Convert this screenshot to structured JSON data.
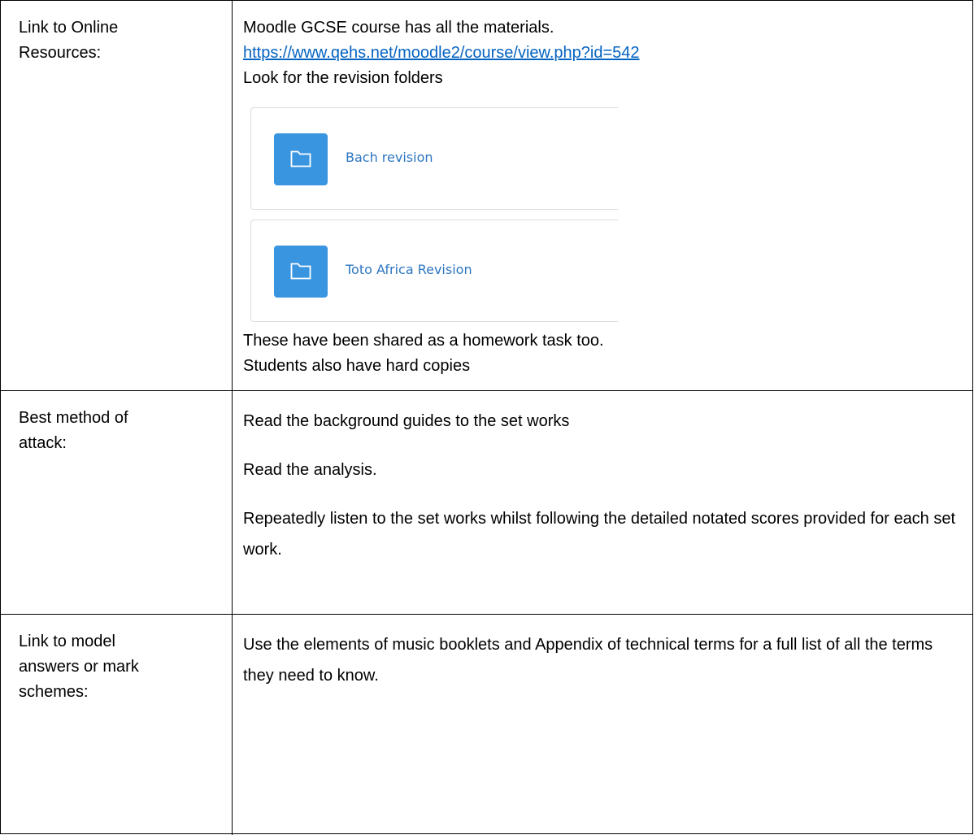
{
  "rows": [
    {
      "label": "Link to Online Resources:",
      "label_lines": [
        "Link to Online",
        "Resources:"
      ],
      "intro": "Moodle GCSE course has all the materials.",
      "url": "https://www.qehs.net/moodle2/course/view.php?id=542",
      "look_for": "Look for the revision folders",
      "folders": [
        {
          "name": "Bach revision",
          "icon": "folder-icon"
        },
        {
          "name": "Toto Africa Revision",
          "icon": "folder-icon"
        }
      ],
      "after_1": "These have been shared as a homework task too.",
      "after_2": "Students also have hard copies"
    },
    {
      "label": "Best method of attack:",
      "label_lines": [
        "Best method of",
        "attack:"
      ],
      "paragraphs": [
        "Read the background guides to the set works",
        "Read the analysis.",
        "Repeatedly listen to the set works whilst following the detailed notated scores provided for each set work."
      ]
    },
    {
      "label": "Link to model answers or mark schemes:",
      "label_lines": [
        "Link to model",
        "answers or mark",
        "schemes:"
      ],
      "paragraphs": [
        "Use the elements of music booklets and Appendix of technical terms for a full list of all the terms they need to know."
      ]
    }
  ],
  "colors": {
    "link": "#0563c1",
    "folder_tile": "#3a95e0",
    "folder_text": "#2d76c1",
    "border": "#000000"
  }
}
